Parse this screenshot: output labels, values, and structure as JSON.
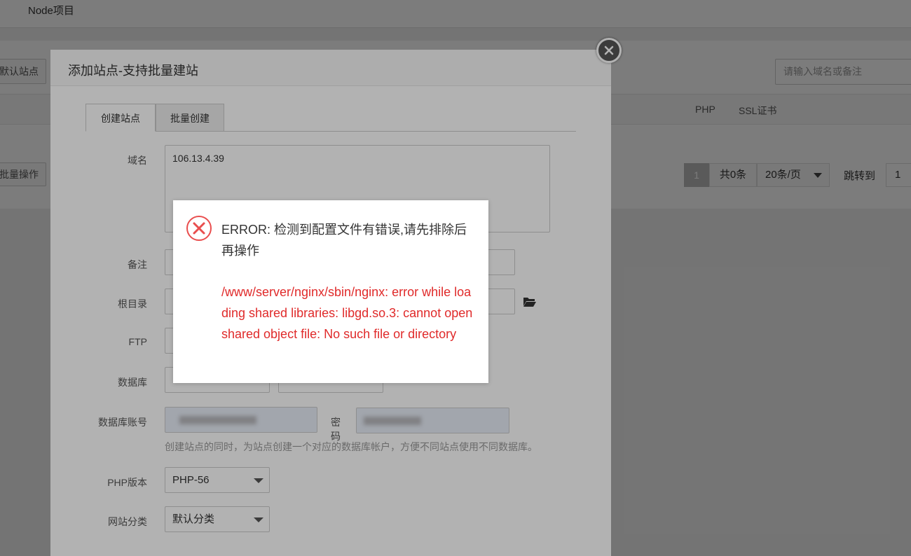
{
  "background": {
    "breadcrumb": "Node项目",
    "default_site_button": "默认站点",
    "search_placeholder": "请输入域名或备注",
    "columns": {
      "php": "PHP",
      "ssl": "SSL证书"
    },
    "batch_button": "批量操作",
    "pager": {
      "current_page": "1",
      "total": "共0条",
      "page_size": "20条/页",
      "jump_label": "跳转到",
      "jump_value": "1"
    }
  },
  "modal": {
    "title": "添加站点-支持批量建站",
    "tabs": {
      "create": "创建站点",
      "batch": "批量创建"
    },
    "labels": {
      "domain": "域名",
      "remark": "备注",
      "root_dir": "根目录",
      "ftp": "FTP",
      "database": "数据库",
      "db_account": "数据库账号",
      "password": "密码",
      "php_version": "PHP版本",
      "category": "网站分类"
    },
    "values": {
      "domain": "106.13.4.39",
      "php_version": "PHP-56",
      "category": "默认分类"
    },
    "hint": "创建站点的同时，为站点创建一个对应的数据库帐户，方便不同站点使用不同数据库。"
  },
  "error_dialog": {
    "title": "ERROR: 检测到配置文件有错误,请先排除后再操作",
    "detail": "/www/server/nginx/sbin/nginx: error while loading shared libraries: libgd.so.3: cannot open shared object file: No such file or directory",
    "colors": {
      "icon": "#e94e4e",
      "detail_text": "#e02a2a"
    }
  }
}
